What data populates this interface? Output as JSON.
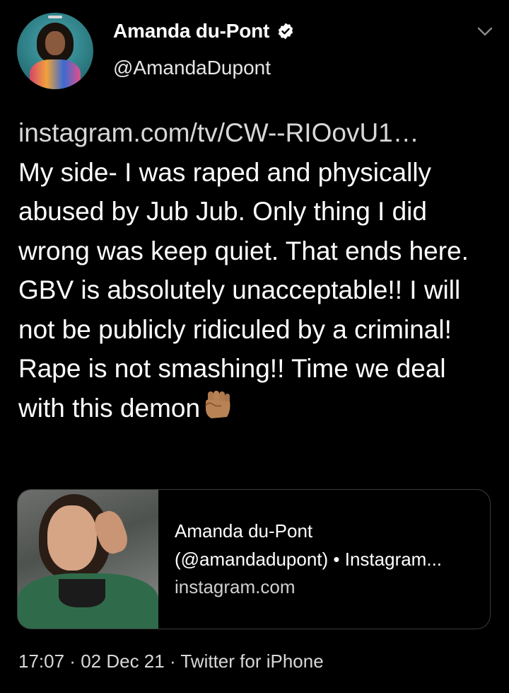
{
  "author": {
    "name": "Amanda du-Pont",
    "handle": "@AmandaDupont",
    "verified": true,
    "avatar_icon": "profile-photo"
  },
  "tweet": {
    "link": "instagram.com/tv/CW--RIOovU1…",
    "text": "My side- I was raped and physically abused by Jub Jub. Only thing I did wrong was keep quiet. That ends here. GBV is absolutely unacceptable!! I will not be publicly ridiculed by a criminal! Rape is not smashing!! Time we deal with this demon",
    "emoji": "✊🏽"
  },
  "card": {
    "title_line1": "Amanda du-Pont",
    "title_line2": "(@amandadupont) • Instagram...",
    "domain": "instagram.com",
    "thumb_icon": "instagram-photo-thumbnail"
  },
  "meta": {
    "time": "17:07",
    "date": "02 Dec 21",
    "source": "Twitter for iPhone",
    "separator": " · "
  },
  "colors": {
    "background": "#000000",
    "text": "#ffffff",
    "secondary_text": "#d8d8d8",
    "card_border": "#3b3b3b",
    "verified_badge": "#ffffff"
  }
}
